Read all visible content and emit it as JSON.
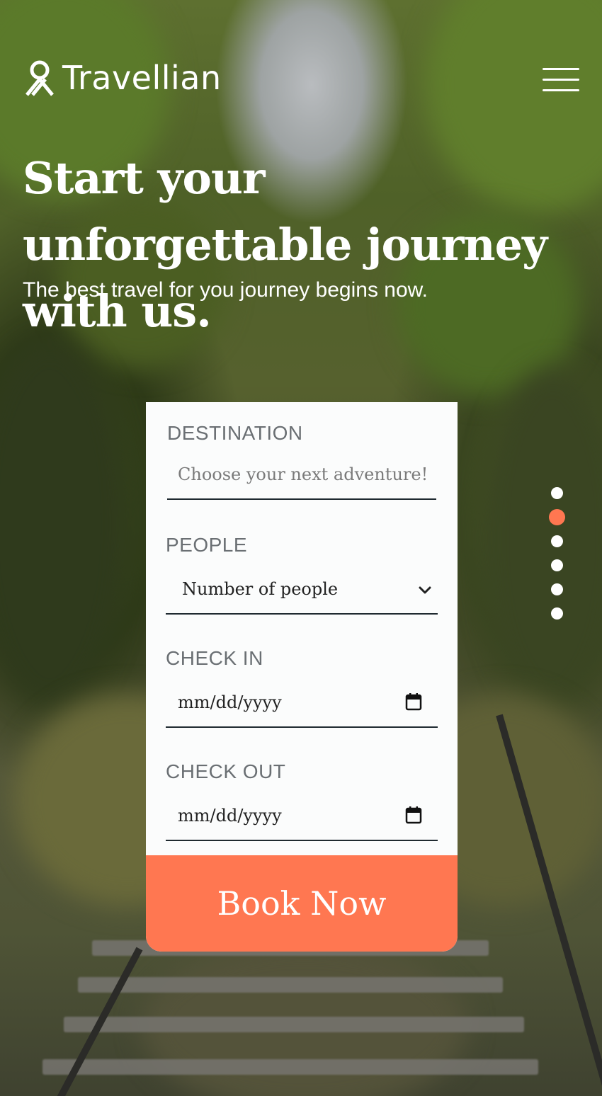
{
  "brand": {
    "name": "Travellian",
    "icon": "location-pin-icon"
  },
  "menu": {
    "icon": "hamburger-menu-icon"
  },
  "hero": {
    "title": "Start your unforgettable journey with us.",
    "subtitle": "The best travel for you journey begins now."
  },
  "booking": {
    "destination": {
      "label": "DESTINATION",
      "placeholder": "Choose your next adventure!"
    },
    "people": {
      "label": "PEOPLE",
      "value": "Number of people",
      "icon": "chevron-down-icon"
    },
    "check_in": {
      "label": "CHECK IN",
      "value": "mm/dd/yyyy",
      "icon": "calendar-icon"
    },
    "check_out": {
      "label": "CHECK OUT",
      "value": "mm/dd/yyyy",
      "icon": "calendar-icon"
    },
    "submit_label": "Book Now"
  },
  "slider": {
    "count": 6,
    "active_index": 1
  },
  "colors": {
    "accent": "#ff7751",
    "card": "#fbfcfc",
    "text": "#ffffff"
  }
}
